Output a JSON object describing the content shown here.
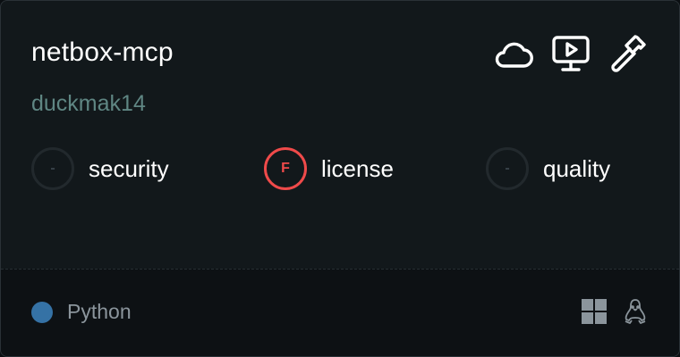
{
  "server": {
    "name": "netbox-mcp",
    "author": "duckmak14"
  },
  "header_icons": [
    {
      "name": "cloud-icon"
    },
    {
      "name": "monitor-play-icon"
    },
    {
      "name": "hammer-icon"
    }
  ],
  "scores": [
    {
      "label": "security",
      "grade": "-",
      "status": "unknown"
    },
    {
      "label": "license",
      "grade": "F",
      "status": "fail"
    },
    {
      "label": "quality",
      "grade": "-",
      "status": "unknown"
    }
  ],
  "footer": {
    "language": "Python",
    "language_color": "#3572a5",
    "platforms": [
      "windows-icon",
      "linux-icon"
    ]
  },
  "colors": {
    "fail": "#ef4a4a",
    "author": "#5f8683"
  }
}
